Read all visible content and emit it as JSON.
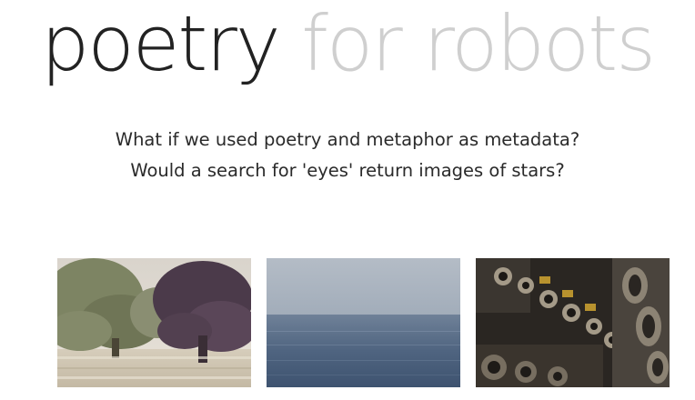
{
  "header": {
    "title_part1": "poetry",
    "title_part2": "for robots"
  },
  "intro": {
    "line1": "What if we used poetry and metaphor as metadata?",
    "line2": "Would a search for 'eyes' return images of stars?"
  },
  "gallery": {
    "images": [
      {
        "name": "trees-photo"
      },
      {
        "name": "sea-photo"
      },
      {
        "name": "engine-photo"
      }
    ]
  },
  "colors": {
    "title_dark": "#222222",
    "title_light": "#cfcfcf",
    "text": "#2a2a2a"
  }
}
